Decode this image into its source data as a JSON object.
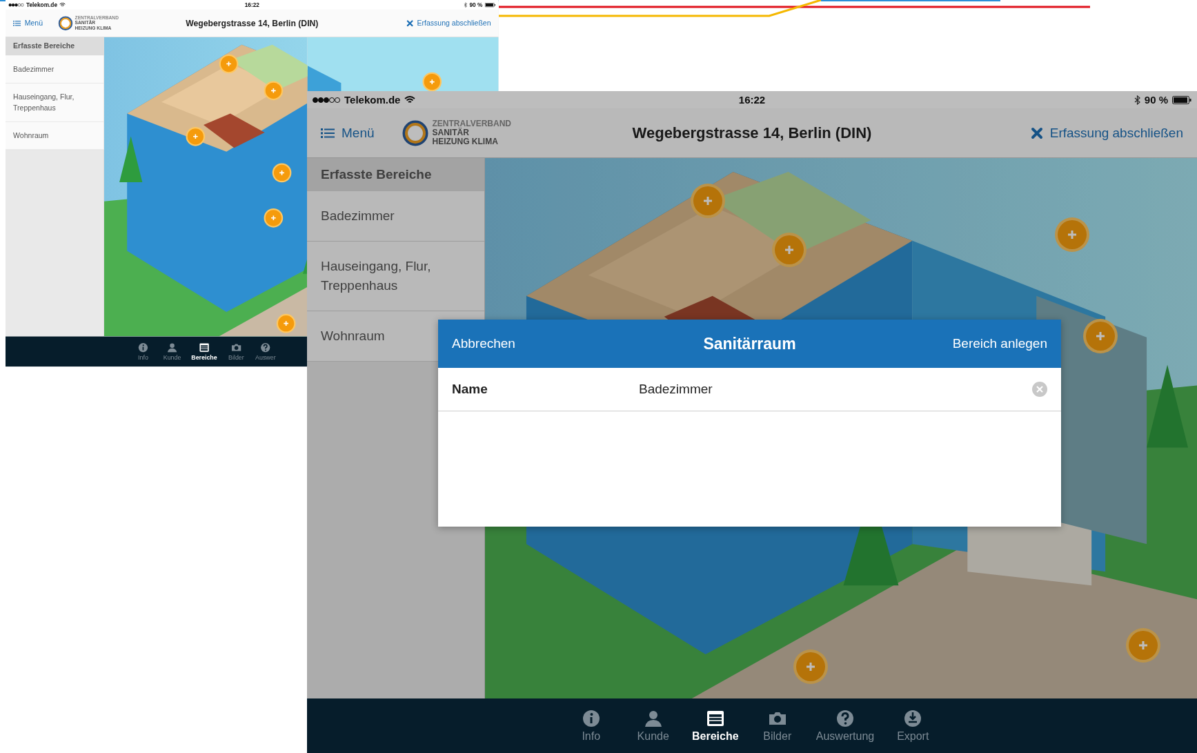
{
  "screens": [
    {
      "status_bar": {
        "carrier": "Telekom.de",
        "time": "16:22",
        "battery": "90 %"
      },
      "header": {
        "menu": "Menü",
        "logo_lines": [
          "ZENTRALVERBAND",
          "SANITÄR",
          "HEIZUNG KLIMA"
        ],
        "title": "Wegebergstrasse 14, Berlin (DIN)",
        "action": "Erfassung abschließen"
      },
      "sidebar": {
        "heading": "Erfasste Bereiche",
        "items": [
          "Badezimmer",
          "Hauseingang, Flur, Treppenhaus",
          "Wohnraum"
        ]
      },
      "tab_bar": [
        {
          "kind": "info",
          "label": "Info",
          "selected": false
        },
        {
          "kind": "person",
          "label": "Kunde",
          "selected": false
        },
        {
          "kind": "list",
          "label": "Bereiche",
          "selected": true
        },
        {
          "kind": "camera",
          "label": "Bilder",
          "selected": false
        },
        {
          "kind": "help",
          "label": "Auswer",
          "selected": false
        }
      ]
    },
    {
      "status_bar": {
        "carrier": "Telekom.de",
        "time": "16:22",
        "battery": "90 %"
      },
      "header": {
        "menu": "Menü",
        "logo_lines": [
          "ZENTRALVERBAND",
          "SANITÄR",
          "HEIZUNG KLIMA"
        ],
        "title": "Wegebergstrasse 14, Berlin (DIN)",
        "action": "Erfassung abschließen"
      },
      "sidebar": {
        "heading": "Erfasste Bereiche",
        "items": [
          "Badezimmer",
          "Hauseingang, Flur, Treppenhaus",
          "Wohnraum"
        ]
      },
      "tab_bar": [
        {
          "kind": "info",
          "label": "Info",
          "selected": false
        },
        {
          "kind": "person",
          "label": "Kunde",
          "selected": false
        },
        {
          "kind": "list",
          "label": "Bereiche",
          "selected": true
        },
        {
          "kind": "camera",
          "label": "Bilder",
          "selected": false
        },
        {
          "kind": "help",
          "label": "Auswertung",
          "selected": false
        },
        {
          "kind": "export",
          "label": "Export",
          "selected": false
        }
      ],
      "dialog": {
        "cancel": "Abbrechen",
        "title": "Sanitärraum",
        "confirm": "Bereich anlegen",
        "field_label": "Name",
        "field_value": "Badezimmer"
      }
    }
  ]
}
